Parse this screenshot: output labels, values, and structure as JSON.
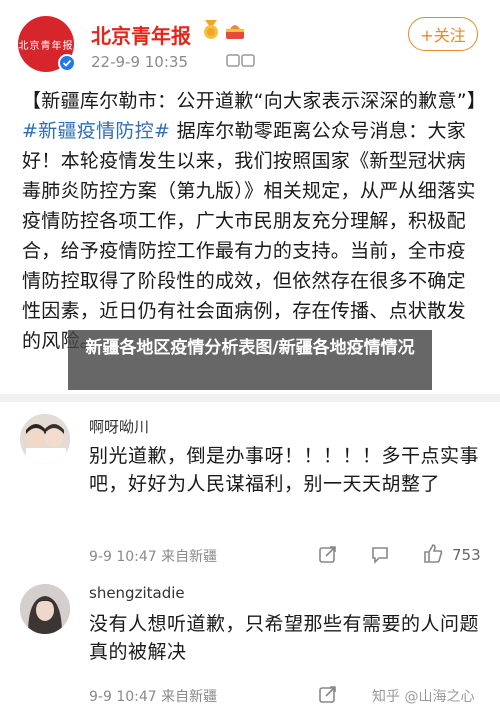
{
  "post": {
    "author": "北京青年报",
    "avatar_text": "北京青年报",
    "time": "22-9-9 10:35",
    "follow_label": "+关注",
    "body_prefix": "【新疆库尔勒市：公开道歉“向大家表示深深的歉意”】",
    "hashtag": "#新疆疫情防控#",
    "body_rest": " 据库尔勒零距离公众号消息：大家好！本轮疫情发生以来，我们按照国家《新型冠状病毒肺炎防控方案（第九版）》相关规定，从严从细落实疫情防控各项工作，广大市民朋友充分理解，积极配合，给予疫情防控工作最有力的支持。当前，全市疫情防控取得了阶段性的成效，但依然存在很多不确定性因素，近日仍有社会面病例，存在传播、点状散发的风险。"
  },
  "overlay": {
    "title": "新疆各地区疫情分析表图/新疆各地疫情情况"
  },
  "comments": [
    {
      "user": "啊呀呦川",
      "text": "别光道歉，倒是办事呀！！！！！多干点实事吧，好好为人民谋福利，别一天天胡整了",
      "time": "9-9 10:47 来自新疆",
      "likes": "753"
    },
    {
      "user": "shengzitadie",
      "text": "没有人想听道歉，只希望那些有需要的人问题真的被解决",
      "time": "9-9 10:47 来自新疆",
      "likes": ""
    }
  ],
  "watermark": "知乎 @山海之心",
  "colors": {
    "brand_red": "#e4261a",
    "hashtag_blue": "#2f6fb6",
    "follow_orange": "#e58a28",
    "verified_blue": "#1f7ae8"
  },
  "icons": [
    "verified-icon",
    "medal-icon",
    "cake-icon",
    "repost-icon",
    "comment-icon",
    "like-icon"
  ]
}
